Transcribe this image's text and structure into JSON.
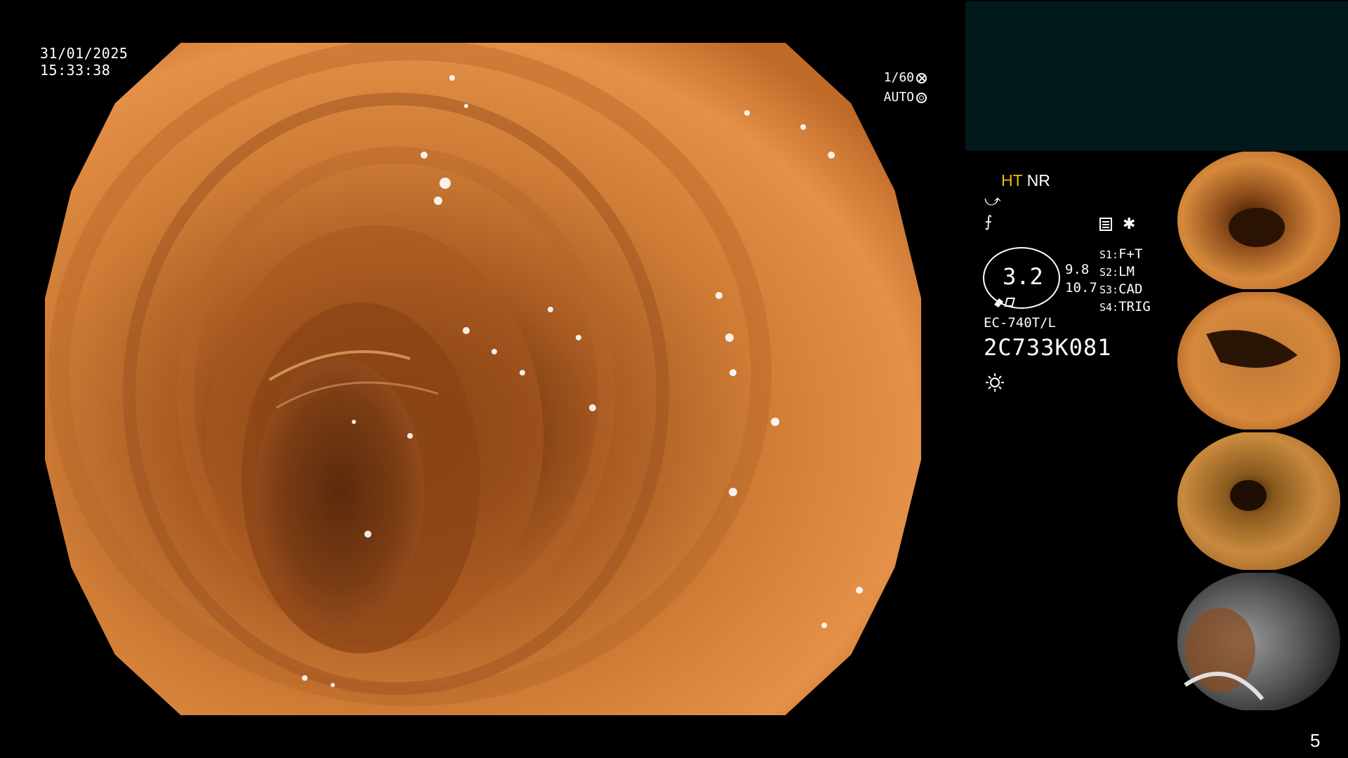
{
  "overlay": {
    "date": "31/01/2025",
    "time": "15:33:38",
    "shutter_label": "1/60",
    "iris_label": "AUTO"
  },
  "info_panel": {
    "ht_label": "HT",
    "nr_label": "NR",
    "zoom_value": "3.2",
    "value_a": "9.8",
    "value_b": "10.7",
    "switches": [
      {
        "key": "S1:",
        "value": "F+T"
      },
      {
        "key": "S2:",
        "value": "LM"
      },
      {
        "key": "S3:",
        "value": "CAD"
      },
      {
        "key": "S4:",
        "value": "TRIG"
      }
    ],
    "scope_model": "EC-740T/L",
    "scope_serial": "2C733K081"
  },
  "thumbnails": [
    {
      "name": "capture-1"
    },
    {
      "name": "capture-2"
    },
    {
      "name": "capture-3"
    },
    {
      "name": "capture-4"
    }
  ],
  "page_number": "5",
  "colors": {
    "info_box": "#02191b",
    "ht_accent": "#f0b800",
    "mucosa": "#c8712a"
  }
}
